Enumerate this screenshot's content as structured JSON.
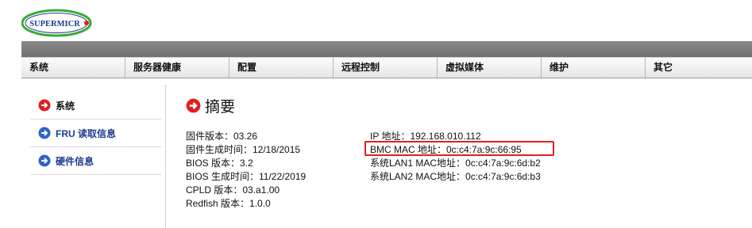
{
  "brand": {
    "logo_text": "SUPERMICR",
    "accent": "#e02020",
    "logo_blue": "#1d3d8f",
    "logo_green": "#3aa935"
  },
  "menu": [
    {
      "label": "系统"
    },
    {
      "label": "服务器健康"
    },
    {
      "label": "配置"
    },
    {
      "label": "远程控制"
    },
    {
      "label": "虚拟媒体"
    },
    {
      "label": "维护"
    },
    {
      "label": "其它"
    }
  ],
  "sidebar": {
    "items": [
      {
        "label": "系统",
        "icon": "red-arrow-circle-icon",
        "active": true
      },
      {
        "label": "FRU 读取信息",
        "icon": "blue-arrow-circle-icon",
        "active": false
      },
      {
        "label": "硬件信息",
        "icon": "blue-arrow-circle-icon",
        "active": false
      }
    ]
  },
  "main": {
    "title": "摘要",
    "left": [
      "固件版本：03.26",
      "固件生成时间：12/18/2015",
      "BIOS 版本：3.2",
      "BIOS 生成时间：11/22/2019",
      "CPLD 版本：03.a1.00",
      "Redfish 版本：1.0.0"
    ],
    "right": [
      "IP 地址：192.168.010.112",
      "BMC MAC 地址：0c:c4:7a:9c:66:95",
      "系统LAN1 MAC地址：0c:c4:7a:9c:6d:b2",
      "系统LAN2 MAC地址：0c:c4:7a:9c:6d:b3"
    ]
  }
}
